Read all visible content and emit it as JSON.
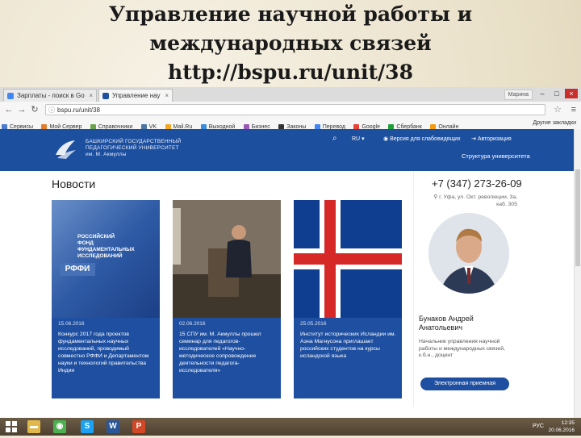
{
  "slide": {
    "title_lines": [
      "Управление научной работы и",
      "международных связей",
      "http://bspu.ru/unit/38"
    ]
  },
  "browser": {
    "tabs": [
      {
        "label": "Зарплаты - поиск в Google",
        "icon_color": "#4285f4"
      },
      {
        "label": "Управление научной р",
        "icon_color": "#1e4fa0"
      }
    ],
    "profile": "Марина",
    "url": "bspu.ru/unit/38",
    "bookmarks": [
      "Сервисы",
      "Мой Сервер",
      "Справочники",
      "VK",
      "Mail.Ru",
      "Выходной",
      "Бизнес",
      "Законы",
      "Перевод",
      "Google",
      "Сбербанк",
      "Онлайн"
    ],
    "other_bookmarks": "Другие закладки"
  },
  "site": {
    "university_name": [
      "БАШКИРСКИЙ ГОСУДАРСТВЕННЫЙ",
      "ПЕДАГОГИЧЕСКИЙ УНИВЕРСИТЕТ",
      "им. М. Акмуллы"
    ],
    "lang": "RU",
    "blind_version": "Версия для слабовидящих",
    "login": "Авторизация",
    "structure": "Структура университета",
    "news_heading": "Новости",
    "news": [
      {
        "date": "15.06.2016",
        "text": "Конкурс 2017 года проектов фундаментальных научных исследований, проводимый совместно РФФИ и Департаментом науки и технологий правительства Индии",
        "image": "rffi"
      },
      {
        "date": "02.06.2016",
        "text": "15 СПУ им. М. Акмуллы прошел семинар для педагогов-исследователей «Научно-методическое сопровождение деятельности педагога-исследователя»",
        "image": "photo"
      },
      {
        "date": "25.05.2016",
        "text": "Институт исторических Исландии им. Аэна Магнусона приглашает российских студентов на курсы исландской языка",
        "image": "flag"
      }
    ],
    "rffi_label": "РФФИ",
    "rffi_text": [
      "РОССИЙСКИЙ",
      "ФОНД",
      "ФУНДАМЕНТАЛЬНЫХ",
      "ИССЛЕДОВАНИЙ"
    ],
    "contact": {
      "phone": "+7 (347) 273-26-09",
      "address": "г. Уфа, ул. Окт. революции, 3а, каб. 305",
      "person_name": [
        "Бунаков Андрей",
        "Анатольевич"
      ],
      "person_role": "Начальник управления научной работы и международных связей, к.б.н., доцент",
      "reception_button": "Электронная приемная"
    }
  },
  "taskbar": {
    "lang": "РУС",
    "time": "12:35",
    "date": "20.06.2016"
  }
}
